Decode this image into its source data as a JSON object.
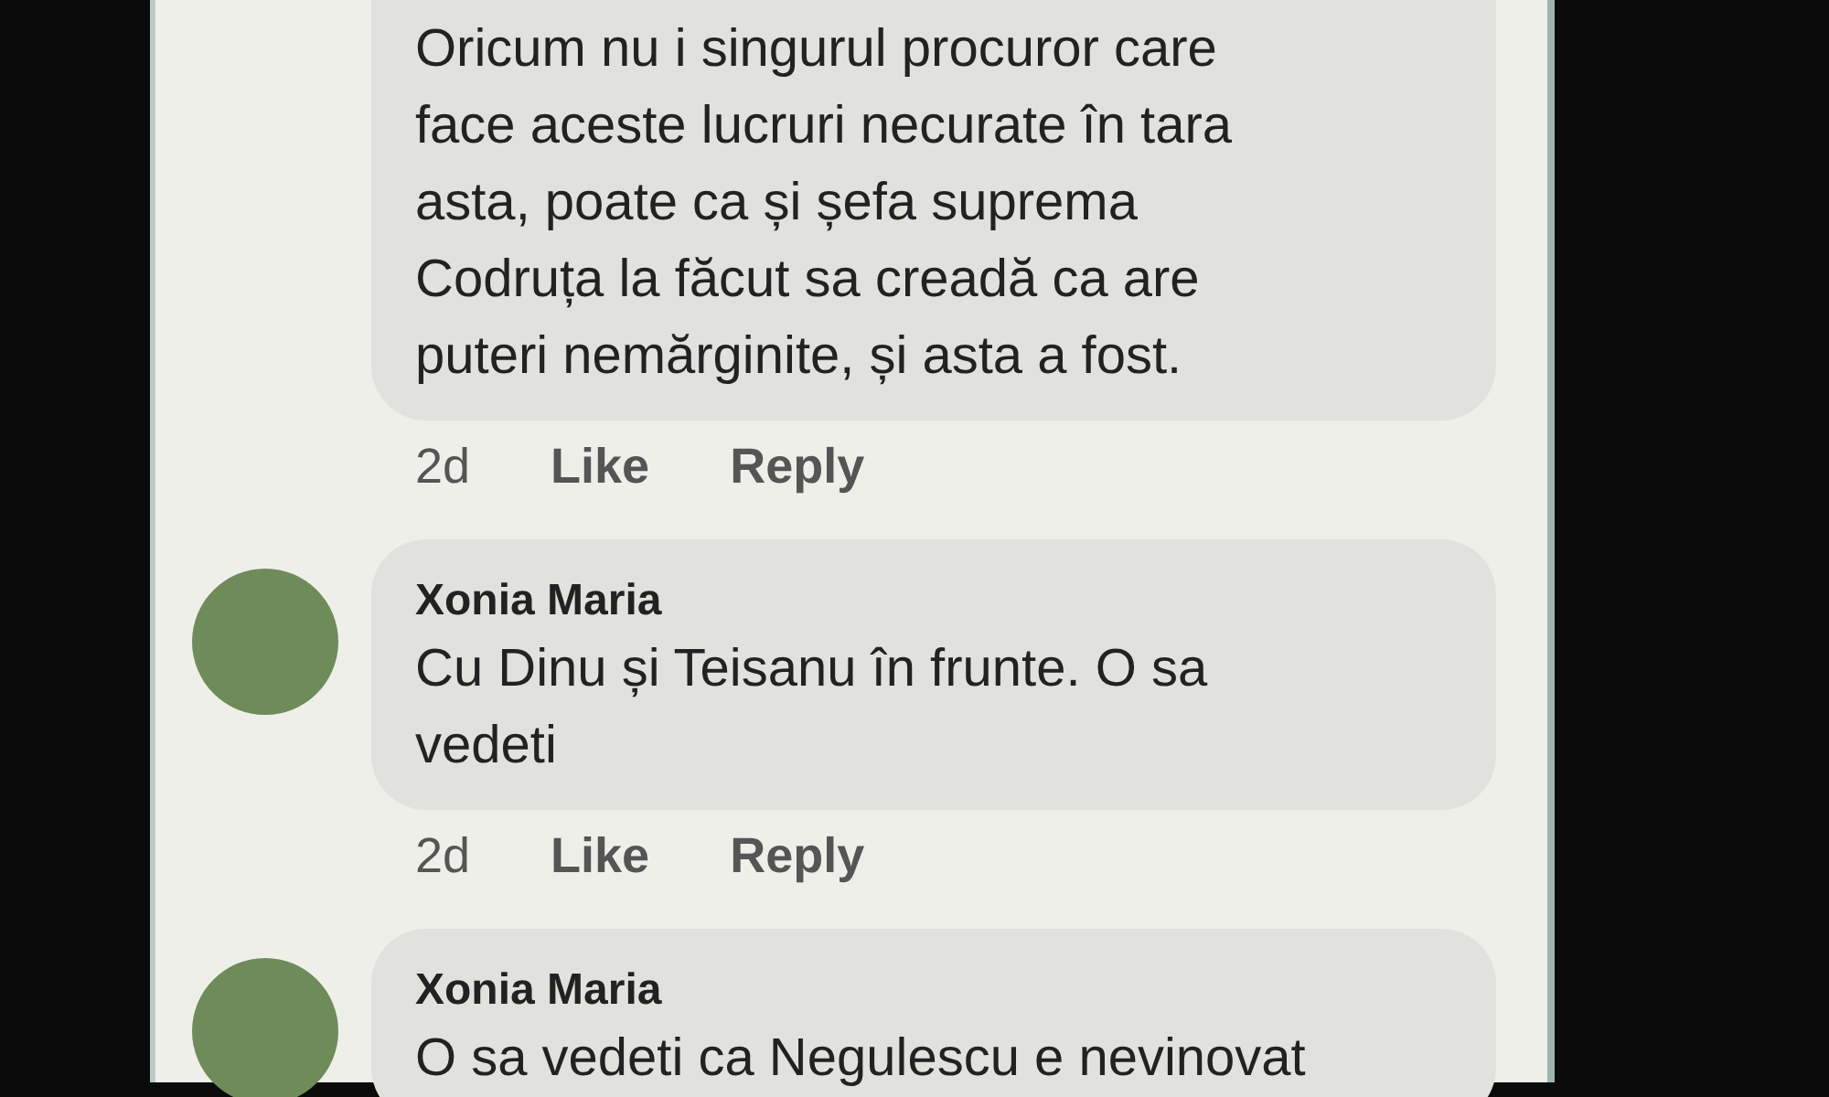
{
  "comments": [
    {
      "lines": [
        "Oricum nu i singurul procuror care",
        "face aceste lucruri necurate în tara",
        "asta, poate ca și șefa suprema",
        "Codruța la făcut sa creadă ca are",
        "puteri nemărginite, și asta a fost."
      ],
      "time": "2d",
      "like": "Like",
      "reply": "Reply"
    },
    {
      "author": "Xonia Maria",
      "lines": [
        "Cu Dinu și Teisanu în frunte. O sa",
        "vedeti"
      ],
      "time": "2d",
      "like": "Like",
      "reply": "Reply"
    },
    {
      "author": "Xonia Maria",
      "lines": [
        "O sa vedeti ca Negulescu e nevinovat"
      ]
    }
  ]
}
